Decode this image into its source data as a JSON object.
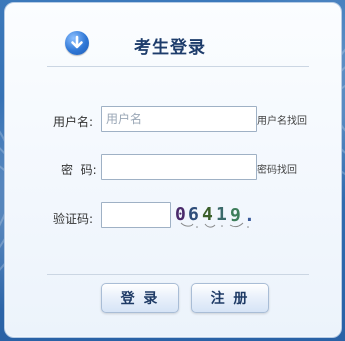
{
  "header": {
    "title": "考生登录",
    "icon": "arrow-down-circle-icon"
  },
  "form": {
    "username": {
      "label": "用户名:",
      "placeholder": "用户名",
      "value": "",
      "recover_link": "用户名找回"
    },
    "password": {
      "label": "密  码:",
      "value": "",
      "recover_link": "密码找回"
    },
    "captcha": {
      "label": "验证码:",
      "value": "",
      "image_text": "06419."
    }
  },
  "buttons": {
    "login": "登 录",
    "register": "注 册"
  },
  "colors": {
    "background": "#2f6fb3",
    "panel": "#f4f8fd",
    "title": "#1d3c6b",
    "captcha_digits": [
      "#4a2a6b",
      "#2e4d7a",
      "#3b5f2a",
      "#3a6a6a",
      "#3d7d5a",
      "#3a5a9a"
    ]
  }
}
